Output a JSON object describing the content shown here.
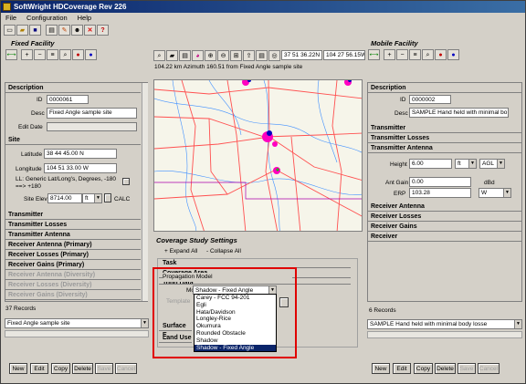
{
  "app": {
    "title": "SoftWright HDCoverage Rev 226"
  },
  "menu": [
    "File",
    "Configuration",
    "Help"
  ],
  "fixed": {
    "section_title": "Fixed Facility",
    "description_hdr": "Description",
    "id_label": "ID",
    "id": "0000061",
    "desc_label": "Desc",
    "desc": "Fixed Angle sample site",
    "edit_date_label": "Edit Date",
    "edit_date": "",
    "site_hdr": "Site",
    "lat_label": "Latitude",
    "lat": "38 44 45.00 N",
    "lon_label": "Longitude",
    "lon": "104 51 33.00 W",
    "ll_note": "LL: Generic Lat/Long's, Degrees, -180 ==> +180",
    "elev_label": "Site Elev",
    "elev": "8714.00",
    "elev_unit": "ft",
    "calc": "CALC",
    "sections": [
      "Transmitter",
      "Transmitter Losses",
      "Transmitter Antenna",
      "Receiver Antenna (Primary)",
      "Receiver Losses (Primary)",
      "Receiver Gains (Primary)"
    ],
    "dim_sections": [
      "Receiver Antenna (Diversity)",
      "Receiver Losses (Diversity)",
      "Receiver Gains (Diversity)"
    ],
    "records": "37 Records",
    "record_selected": "Fixed Angle sample site",
    "buttons": [
      "New",
      "Edit",
      "Copy",
      "Delete",
      "Save",
      "Cancel"
    ]
  },
  "map": {
    "coord_lat": "37 51 36.22N",
    "coord_lon": "104 27 56.15W",
    "status": "104.22 km Azimuth 160.51 from Fixed Angle sample site"
  },
  "coverage": {
    "title": "Coverage Study Settings",
    "expand": "+ Expand All",
    "collapse": "- Collapse All",
    "sections": [
      "Task",
      "Coverage Area",
      "Topo Data"
    ],
    "prop_hdr": "Propagation Model",
    "model_label": "Model",
    "model": "Shadow - Fixed Angle",
    "template_label": "Template",
    "options": [
      "Carey - FCC 94-201",
      "Egli",
      "Hata/Davidson",
      "Longley-Rice",
      "Okumura",
      "Rounded Obstacle",
      "Shadow",
      "Shadow - Fixed Angle"
    ],
    "lower_sections": [
      "Surface E",
      "Land Use"
    ]
  },
  "mobile": {
    "section_title": "Mobile Facility",
    "description_hdr": "Description",
    "id_label": "ID",
    "id": "0000002",
    "desc_label": "Desc",
    "desc": "SAMPLE Hand held with minimal bo",
    "transmitter": "Transmitter",
    "tx_losses": "Transmitter Losses",
    "tx_antenna": "Transmitter Antenna",
    "height_label": "Height",
    "height": "6.00",
    "height_unit": "ft",
    "height_ref": "AGL",
    "gain_label": "Ant Gain",
    "gain": "0.00",
    "gain_unit": "dBd",
    "erp_label": "ERP",
    "erp": "103.28",
    "erp_unit": "W",
    "sections": [
      "Receiver Antenna",
      "Receiver Losses",
      "Receiver Gains",
      "Receiver"
    ],
    "records": "6 Records",
    "record_selected": "SAMPLE Hand held with minimal body losse",
    "buttons": [
      "New",
      "Edit",
      "Copy",
      "Delete",
      "Save",
      "Cancel"
    ]
  }
}
